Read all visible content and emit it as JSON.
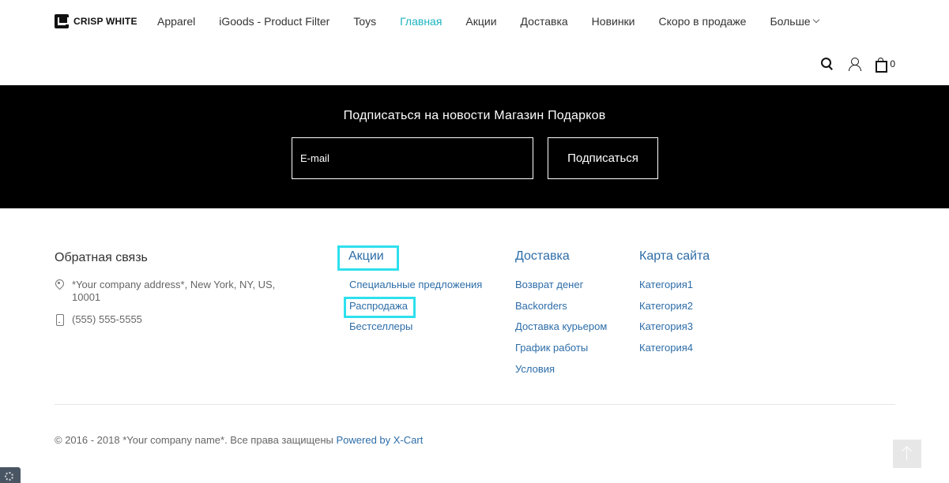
{
  "header": {
    "logo_text": "CRISP WHITE",
    "nav": [
      {
        "label": "Apparel",
        "active": false
      },
      {
        "label": "iGoods - Product Filter",
        "active": false
      },
      {
        "label": "Toys",
        "active": false
      },
      {
        "label": "Главная",
        "active": true
      },
      {
        "label": "Акции",
        "active": false
      },
      {
        "label": "Доставка",
        "active": false
      },
      {
        "label": "Новинки",
        "active": false
      },
      {
        "label": "Скоро в продаже",
        "active": false
      }
    ],
    "more_label": "Больше",
    "cart_count": "0"
  },
  "subscribe": {
    "title": "Подписаться на новости Магазин Подарков",
    "email_placeholder": "E-mail",
    "button_label": "Подписаться"
  },
  "footer": {
    "contact": {
      "title": "Обратная связь",
      "address": "*Your company address*, New York, NY, US, 10001",
      "phone": "(555) 555-5555"
    },
    "promos": {
      "title": "Акции",
      "links": [
        "Специальные предложения",
        "Распродажа",
        "Бестселлеры"
      ]
    },
    "delivery": {
      "title": "Доставка",
      "links": [
        "Возврат денег",
        "Backorders",
        "Доставка курьером",
        "График работы",
        "Условия"
      ]
    },
    "sitemap": {
      "title": "Карта сайта",
      "links": [
        "Категория1",
        "Категория2",
        "Категория3",
        "Категория4"
      ]
    },
    "copyright": "© 2016 - 2018 *Your company name*. Все права защищены",
    "powered_by": "Powered by X-Cart"
  },
  "colors": {
    "accent": "#1bb3bf",
    "link": "#2d6da8",
    "highlight": "#2ee0ee",
    "band": "#000000"
  }
}
